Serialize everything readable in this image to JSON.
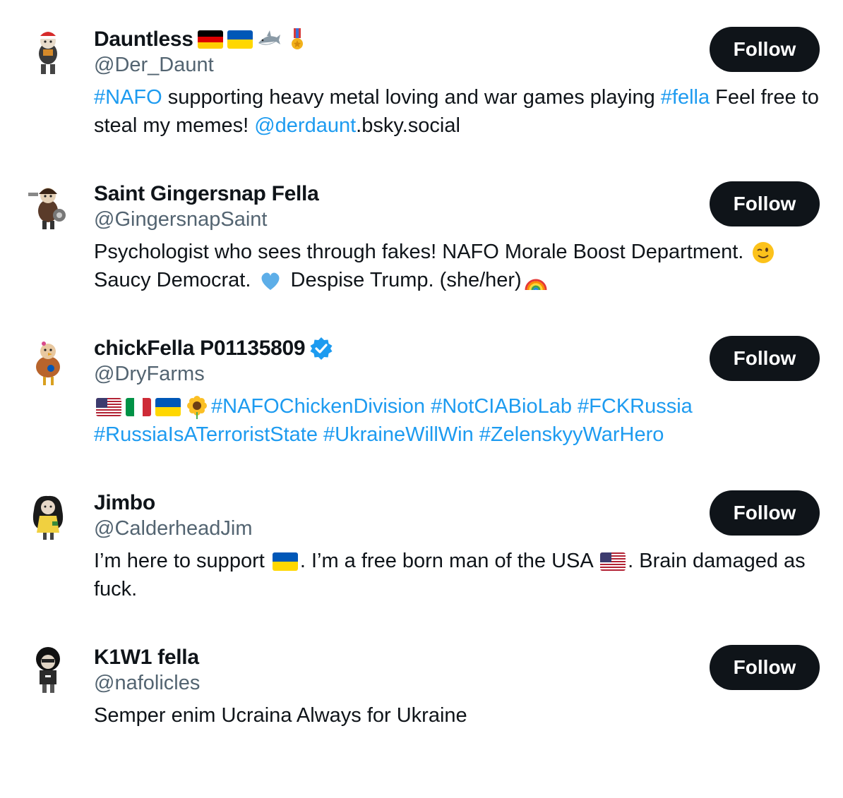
{
  "follow_label": "Follow",
  "accent_color": "#1d9bf0",
  "users": [
    {
      "name": "Dauntless",
      "name_icons": [
        "germany-flag-icon",
        "ukraine-flag-icon",
        "shark-icon",
        "military-medal-icon"
      ],
      "handle": "@Der_Daunt",
      "bio": [
        {
          "text": "#NAFO",
          "link": true
        },
        {
          "text": " supporting heavy metal loving and war games playing ",
          "link": false
        },
        {
          "text": "#fella",
          "link": true
        },
        {
          "text": " Feel free to steal my memes! ",
          "link": false
        },
        {
          "text": "@derdaunt",
          "link": true
        },
        {
          "text": ".bsky.social",
          "link": false
        }
      ]
    },
    {
      "name": "Saint Gingersnap Fella",
      "handle": "@GingersnapSaint",
      "bio": [
        {
          "text": "Psychologist who sees through fakes! NAFO Morale Boost Department. ",
          "link": false
        },
        {
          "icon": "winking-face-icon"
        },
        {
          "text": " Saucy Democrat. ",
          "link": false
        },
        {
          "icon": "blue-heart-icon"
        },
        {
          "text": " Despise Trump. (she/her)",
          "link": false
        },
        {
          "icon": "rainbow-icon"
        }
      ]
    },
    {
      "name": "chickFella P01135809",
      "verified": true,
      "handle": "@DryFarms",
      "bio": [
        {
          "icon": "usa-flag-icon"
        },
        {
          "icon": "italy-flag-icon"
        },
        {
          "icon": "ukraine-flag-icon"
        },
        {
          "icon": "sunflower-icon"
        },
        {
          "text": "#NAFOChickenDivision",
          "link": true
        },
        {
          "text": " ",
          "link": false
        },
        {
          "text": "#NotCIABioLab",
          "link": true
        },
        {
          "text": " ",
          "link": false
        },
        {
          "text": "#FCKRussia",
          "link": true
        },
        {
          "text": " ",
          "link": false
        },
        {
          "text": "#RussiaIsATerroristState",
          "link": true
        },
        {
          "text": " ",
          "link": false
        },
        {
          "text": "#UkraineWillWin",
          "link": true
        },
        {
          "text": " ",
          "link": false
        },
        {
          "text": "#ZelenskyyWarHero",
          "link": true
        }
      ]
    },
    {
      "name": "Jimbo",
      "handle": "@CalderheadJim",
      "bio": [
        {
          "text": "I’m here to support ",
          "link": false
        },
        {
          "icon": "ukraine-flag-icon"
        },
        {
          "text": ". I’m a free born man of the USA ",
          "link": false
        },
        {
          "icon": "usa-flag-icon"
        },
        {
          "text": ". Brain damaged as fuck.",
          "link": false
        }
      ]
    },
    {
      "name": "K1W1 fella",
      "handle": "@nafolicles",
      "bio": [
        {
          "text": "Semper enim Ucraina Always for Ukraine",
          "link": false
        }
      ]
    }
  ]
}
